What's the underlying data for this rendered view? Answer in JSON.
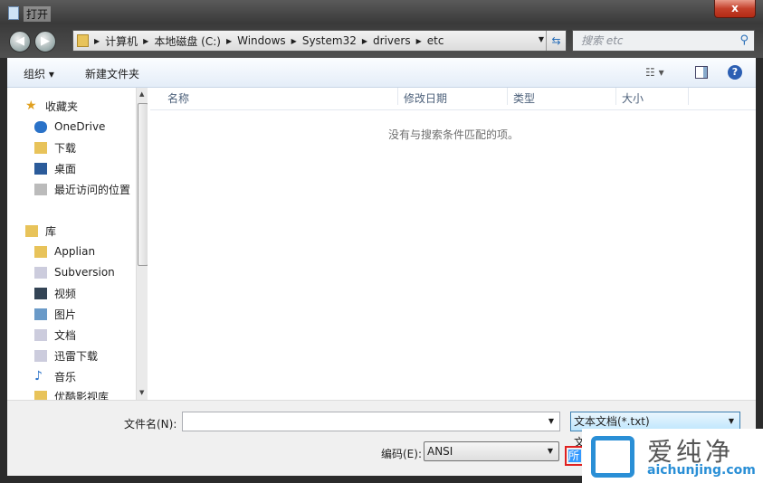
{
  "window": {
    "title": "打开",
    "close": "x"
  },
  "address": {
    "crumbs": [
      "计算机",
      "本地磁盘 (C:)",
      "Windows",
      "System32",
      "drivers",
      "etc"
    ]
  },
  "search": {
    "placeholder": "搜索 etc"
  },
  "toolbar": {
    "organize": "组织 ▾",
    "new_folder": "新建文件夹"
  },
  "sidebar": {
    "items": [
      "收藏夹",
      "OneDrive",
      "下载",
      "桌面",
      "最近访问的位置",
      "库",
      "Applian",
      "Subversion",
      "视频",
      "图片",
      "文档",
      "迅雷下载",
      "音乐",
      "优酷影视库"
    ]
  },
  "columns": [
    "名称",
    "修改日期",
    "类型",
    "大小"
  ],
  "empty_message": "没有与搜索条件匹配的项。",
  "bottom": {
    "filename_label": "文件名(N):",
    "filename_value": "",
    "filetype": "文本文档(*.txt)",
    "filetype_partial": "文",
    "encoding_label": "编码(E):",
    "encoding_value": "ANSI",
    "all_partial": "所"
  },
  "watermark": {
    "cn": "爱纯净",
    "en": "aichunjing.com"
  }
}
